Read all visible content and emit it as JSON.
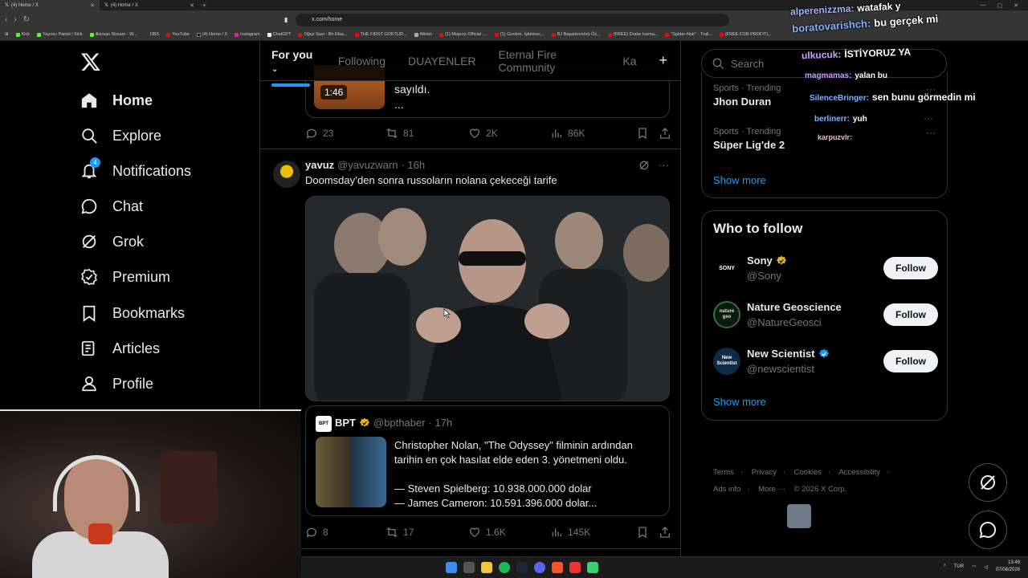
{
  "browser": {
    "tabs": [
      {
        "label": "(4) Home / X",
        "active": true
      },
      {
        "label": "(4) Home / X",
        "active": false
      }
    ],
    "url": "x.com/home",
    "bookmarks": [
      "Kick",
      "Yayıncı Paneli | Kick",
      "ilkinsan Stream - W...",
      "OBS",
      "YouTube",
      "(4) Home / X",
      "Instagram",
      "ChatGPT",
      "Oğuz Sasi - Bir Efsa...",
      "THE FIRST GOKTUR...",
      "Albüm",
      "(1) Meproz Official -...",
      "(1) Gordon, İşletmec...",
      "BJ Başantrenörü Öz...",
      "(FREE) Drake Icema...",
      "\"Spider-Noir\" - Trail...",
      "(FREE FOR PROFIT)..."
    ],
    "all_bookmarks": "All Bookmarks"
  },
  "nav": {
    "items": [
      {
        "label": "Home",
        "icon": "home-icon"
      },
      {
        "label": "Explore",
        "icon": "search-icon"
      },
      {
        "label": "Notifications",
        "icon": "bell-icon",
        "badge": "4"
      },
      {
        "label": "Chat",
        "icon": "chat-icon"
      },
      {
        "label": "Grok",
        "icon": "grok-icon"
      },
      {
        "label": "Premium",
        "icon": "premium-icon"
      },
      {
        "label": "Bookmarks",
        "icon": "bookmark-icon"
      },
      {
        "label": "Articles",
        "icon": "articles-icon"
      },
      {
        "label": "Profile",
        "icon": "profile-icon"
      }
    ]
  },
  "timeline": {
    "tabs": [
      "For you",
      "Following",
      "DUAYENLER",
      "Eternal Fire Community",
      "Ka"
    ],
    "prev_post": {
      "duration": "1:46",
      "text_line1": "sayıldı.",
      "text_line2": "...",
      "stats": {
        "replies": "23",
        "reposts": "81",
        "likes": "2K",
        "views": "86K"
      }
    },
    "post": {
      "name": "yavuz",
      "handle": "@yavuzwarn",
      "time": "· 16h",
      "text": "Doomsday’den sonra russoların nolana çekeceği tarife",
      "quote": {
        "avatar_text": "BPT",
        "name": "BPT",
        "handle": "@bpthaber",
        "time": "· 17h",
        "line1": "Christopher Nolan, \"The Odyssey\" filminin ardından tarihin en çok hasılat elde eden 3. yönetmeni oldu.",
        "line2": "— Steven Spielberg: 10.938.000.000 dolar",
        "line3": "— James Cameron: 10.591.396.000 dolar..."
      },
      "stats": {
        "replies": "8",
        "reposts": "17",
        "likes": "1.6K",
        "views": "145K"
      }
    }
  },
  "sidebar": {
    "search_placeholder": "Search",
    "trends": [
      {
        "meta": "Sports · Trending",
        "title": "Jhon Duran"
      },
      {
        "meta": "Sports · Trending",
        "title": "Süper Lig'de 2"
      }
    ],
    "show_more": "Show more",
    "who_to_follow": {
      "title": "Who to follow",
      "accounts": [
        {
          "name": "Sony",
          "handle": "@Sony",
          "avatar_text": "SONY",
          "verified": "gold"
        },
        {
          "name": "Nature Geoscience",
          "handle": "@NatureGeosci",
          "avatar_text": "nature geo",
          "verified": "none"
        },
        {
          "name": "New Scientist",
          "handle": "@newscientist",
          "avatar_text": "New Scientist",
          "verified": "blue"
        }
      ],
      "follow_label": "Follow",
      "show_more": "Show more"
    },
    "footer": {
      "links": [
        "Terms",
        "Privacy",
        "Cookies",
        "Accessibility",
        "Ads info",
        "More ···"
      ],
      "copyright": "© 2026 X Corp."
    }
  },
  "stream_chat": [
    {
      "user": "alperenizzma:",
      "msg": "watafak y"
    },
    {
      "user": "boratovarishch:",
      "msg": "bu gerçek mi"
    },
    {
      "user": "ulkucuk:",
      "msg": "İSTİYORUZ YA"
    },
    {
      "user": "magmamas:",
      "msg": "yalan bu"
    },
    {
      "user": "SilenceBringer:",
      "msg": "sen bunu görmedin mi"
    },
    {
      "user": "berlinerr:",
      "msg": "yuh"
    },
    {
      "user": "karpuzvlr:",
      "msg": ""
    }
  ],
  "taskbar": {
    "lang": "TUR",
    "time": "13:49",
    "date": "07/08/2026"
  },
  "colors": {
    "accent": "#1d9bf0",
    "bg": "#000000",
    "border": "#2f3336",
    "muted": "#71767b",
    "gold_check": "#e2b719"
  }
}
